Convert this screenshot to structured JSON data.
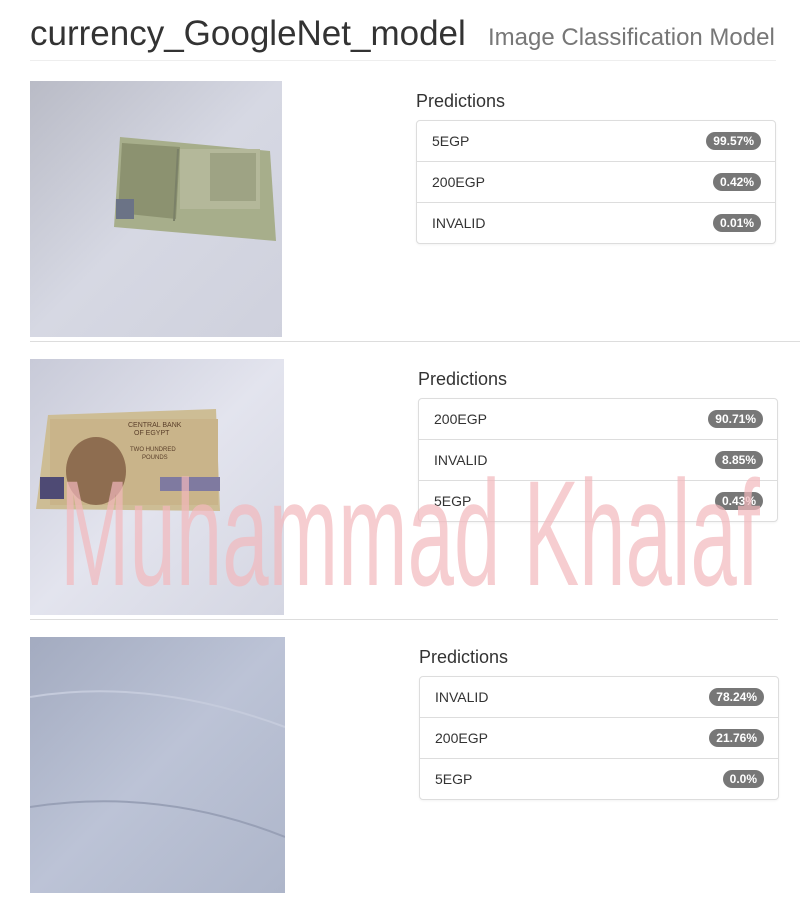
{
  "header": {
    "title": "currency_GoogleNet_model",
    "subtitle": "Image Classification Model"
  },
  "results": [
    {
      "heading": "Predictions",
      "predictions": [
        {
          "label": "5EGP",
          "score": "99.57%"
        },
        {
          "label": "200EGP",
          "score": "0.42%"
        },
        {
          "label": "INVALID",
          "score": "0.01%"
        }
      ]
    },
    {
      "heading": "Predictions",
      "predictions": [
        {
          "label": "200EGP",
          "score": "90.71%"
        },
        {
          "label": "INVALID",
          "score": "8.85%"
        },
        {
          "label": "5EGP",
          "score": "0.43%"
        }
      ]
    },
    {
      "heading": "Predictions",
      "predictions": [
        {
          "label": "INVALID",
          "score": "78.24%"
        },
        {
          "label": "200EGP",
          "score": "21.76%"
        },
        {
          "label": "5EGP",
          "score": "0.0%"
        }
      ]
    }
  ],
  "images": {
    "banknote_200_text_line1": "CENTRAL BANK",
    "banknote_200_text_line2": "OF EGYPT",
    "banknote_200_text_line3": "TWO HUNDRED",
    "banknote_200_text_line4": "POUNDS"
  },
  "watermark": {
    "text": "Muhammad Khalaf",
    "color": "#f2b8bc"
  },
  "colors": {
    "badge": "#777777",
    "border": "#dddddd",
    "subtitle": "#777777"
  }
}
